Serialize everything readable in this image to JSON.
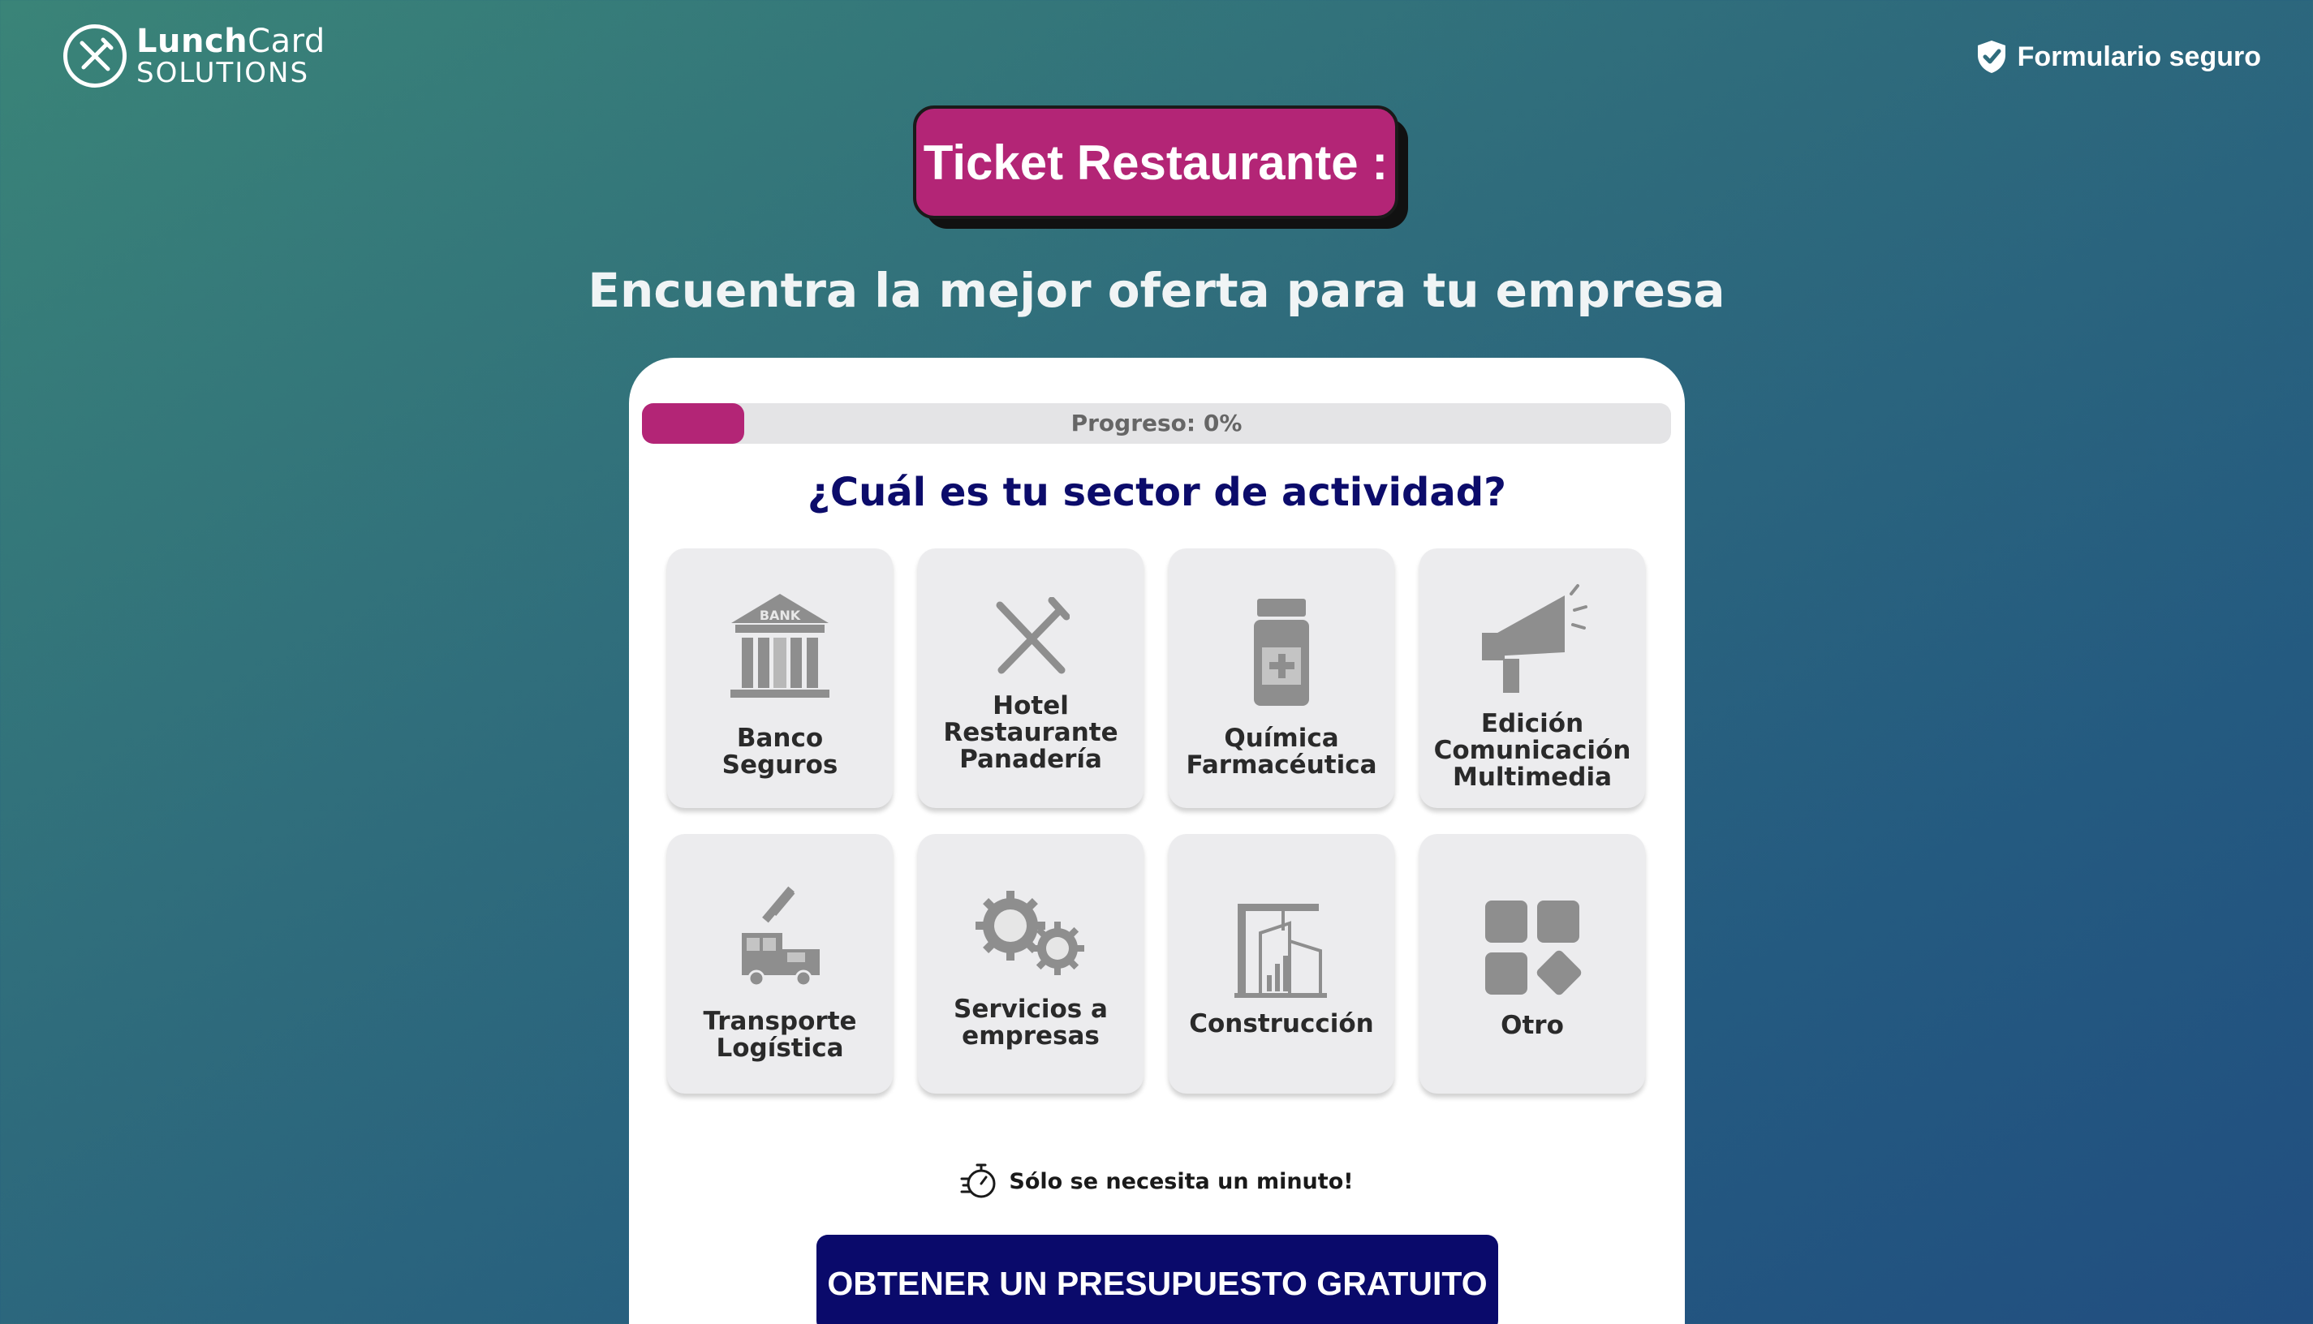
{
  "brand": {
    "name_bold": "Lunch",
    "name_light": "Card",
    "tagline": "SOLUTIONS"
  },
  "header": {
    "secure_label": "Formulario seguro"
  },
  "badge": {
    "title": "Ticket Restaurante :"
  },
  "subtitle": "Encuentra la mejor oferta para tu empresa",
  "progress": {
    "label": "Progreso: 0%",
    "value_percent": 0
  },
  "question": "¿Cuál es tu sector de actividad?",
  "sectors": [
    {
      "icon": "bank-icon",
      "lines": [
        "Banco",
        "Seguros"
      ]
    },
    {
      "icon": "fork-knife-icon",
      "lines": [
        "Hotel",
        "Restaurante",
        "Panadería"
      ]
    },
    {
      "icon": "medicine-bottle-icon",
      "lines": [
        "Química",
        "Farmacéutica"
      ]
    },
    {
      "icon": "megaphone-icon",
      "lines": [
        "Edición",
        "Comunicación",
        "Multimedia"
      ]
    },
    {
      "icon": "truck-plane-icon",
      "lines": [
        "Transporte",
        "Logística"
      ]
    },
    {
      "icon": "gears-icon",
      "lines": [
        "Servicios a",
        "empresas"
      ]
    },
    {
      "icon": "construction-crane-icon",
      "lines": [
        "Construcción"
      ]
    },
    {
      "icon": "grid-shapes-icon",
      "lines": [
        "Otro"
      ]
    }
  ],
  "bank_sign": "BANK",
  "timer_note": "Sólo se necesita un minuto!",
  "cta_label": "OBTENER UN PRESUPUESTO GRATUITO",
  "colors": {
    "accent": "#b32576",
    "navy": "#0a0a6b",
    "tile": "#ececee"
  }
}
